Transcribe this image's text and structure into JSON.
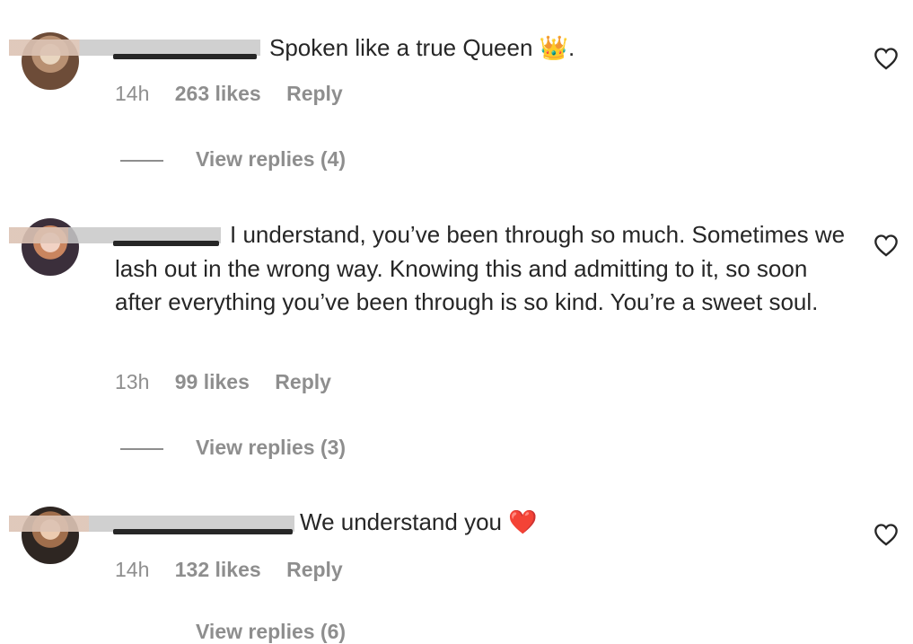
{
  "comments": [
    {
      "text": "Spoken like a true Queen",
      "emoji": "👑",
      "emoji_name": "crown-icon",
      "trail": ".",
      "age": "14h",
      "likes": "263 likes",
      "reply": "Reply",
      "view_replies": "View replies (4)"
    },
    {
      "text": "I understand, you’ve been through so much. Sometimes we lash out in the wrong way. Knowing this and admitting to it, so soon after everything you’ve been through is so kind. You’re a sweet soul.",
      "age": "13h",
      "likes": "99 likes",
      "reply": "Reply",
      "view_replies": "View replies (3)"
    },
    {
      "text": "We understand you",
      "emoji": "❤️",
      "emoji_name": "red-heart-icon",
      "age": "14h",
      "likes": "132 likes",
      "reply": "Reply",
      "view_replies": "View replies (6)"
    }
  ],
  "icons": {
    "like": "heart-outline-icon"
  },
  "colors": {
    "text": "#262626",
    "secondary": "#8e8e8e",
    "heart_red": "#e0245e"
  }
}
